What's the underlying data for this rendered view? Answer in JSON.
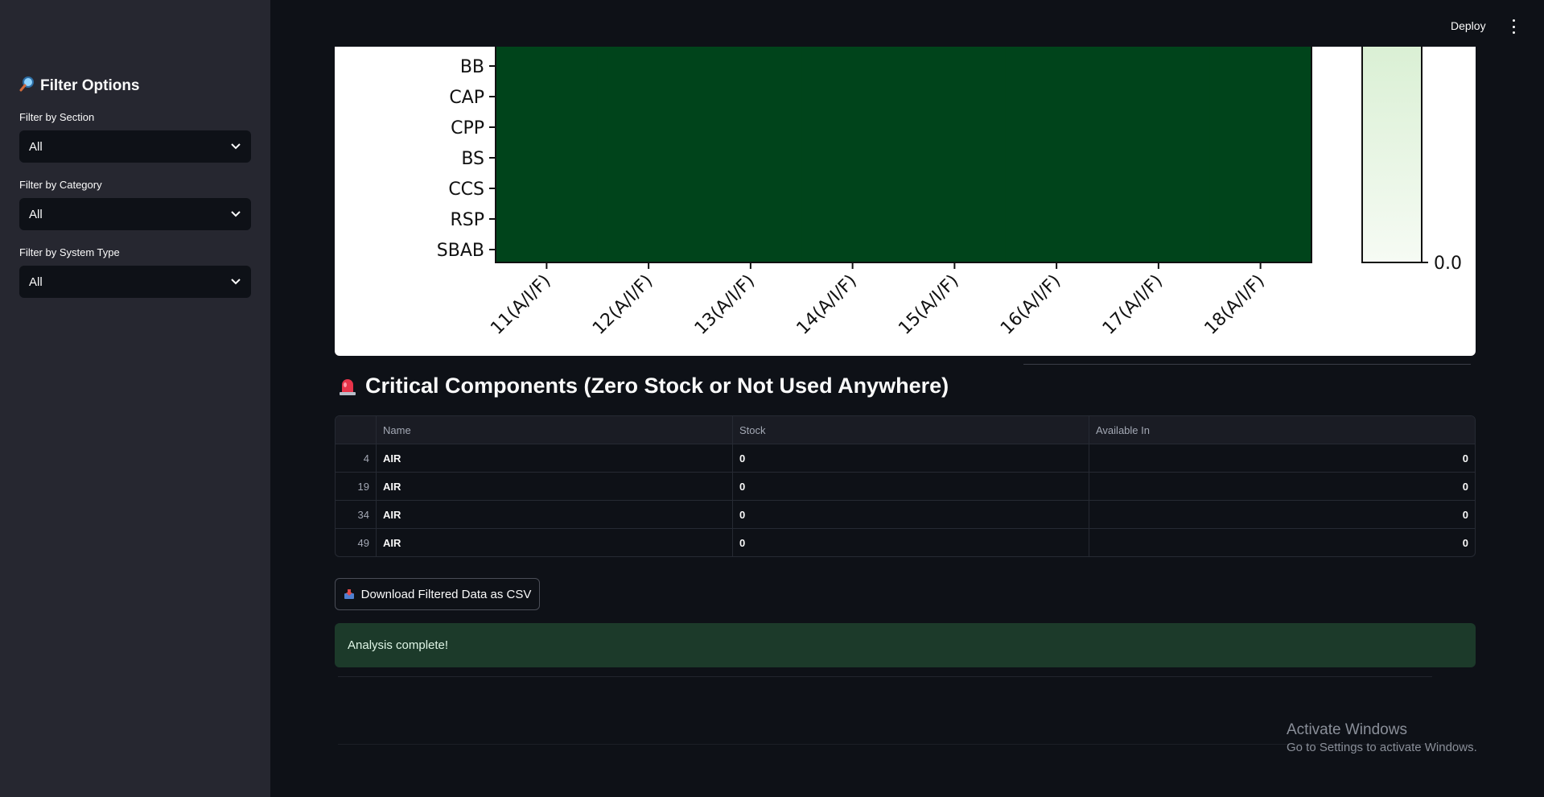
{
  "sidebar": {
    "title": "Filter Options",
    "title_icon": "magnifier-icon",
    "filters": [
      {
        "label": "Filter by Section",
        "value": "All"
      },
      {
        "label": "Filter by Category",
        "value": "All"
      },
      {
        "label": "Filter by System Type",
        "value": "All"
      }
    ]
  },
  "header": {
    "deploy_label": "Deploy",
    "menu_icon": "kebab-menu-icon"
  },
  "chart_data": {
    "type": "heatmap",
    "y_categories": [
      "BB",
      "CAP",
      "CPP",
      "BS",
      "CCS",
      "RSP",
      "SBAB"
    ],
    "x_categories": [
      "11(A/I/F)",
      "12(A/I/F)",
      "13(A/I/F)",
      "14(A/I/F)",
      "15(A/I/F)",
      "16(A/I/F)",
      "17(A/I/F)",
      "18(A/I/F)"
    ],
    "colormap": "Greens",
    "cell_color": "#00441b",
    "colorbar_min_label": "0.0"
  },
  "critical": {
    "title": "Critical Components (Zero Stock or Not Used Anywhere)",
    "icon": "siren-icon",
    "columns": [
      "",
      "Name",
      "Stock",
      "Available In"
    ],
    "rows": [
      {
        "index": "4",
        "name": "AIR",
        "stock": "0",
        "available_in": "0"
      },
      {
        "index": "19",
        "name": "AIR",
        "stock": "0",
        "available_in": "0"
      },
      {
        "index": "34",
        "name": "AIR",
        "stock": "0",
        "available_in": "0"
      },
      {
        "index": "49",
        "name": "AIR",
        "stock": "0",
        "available_in": "0"
      }
    ]
  },
  "download": {
    "label": "Download Filtered Data as CSV",
    "icon": "inbox-tray-icon"
  },
  "status": {
    "message": "Analysis complete!",
    "color": "#1c3a2a"
  },
  "watermark": {
    "line1": "Activate Windows",
    "line2": "Go to Settings to activate Windows."
  },
  "colors": {
    "background": "#0e1117",
    "sidebar": "#262730",
    "heat_cell": "#00441b"
  }
}
